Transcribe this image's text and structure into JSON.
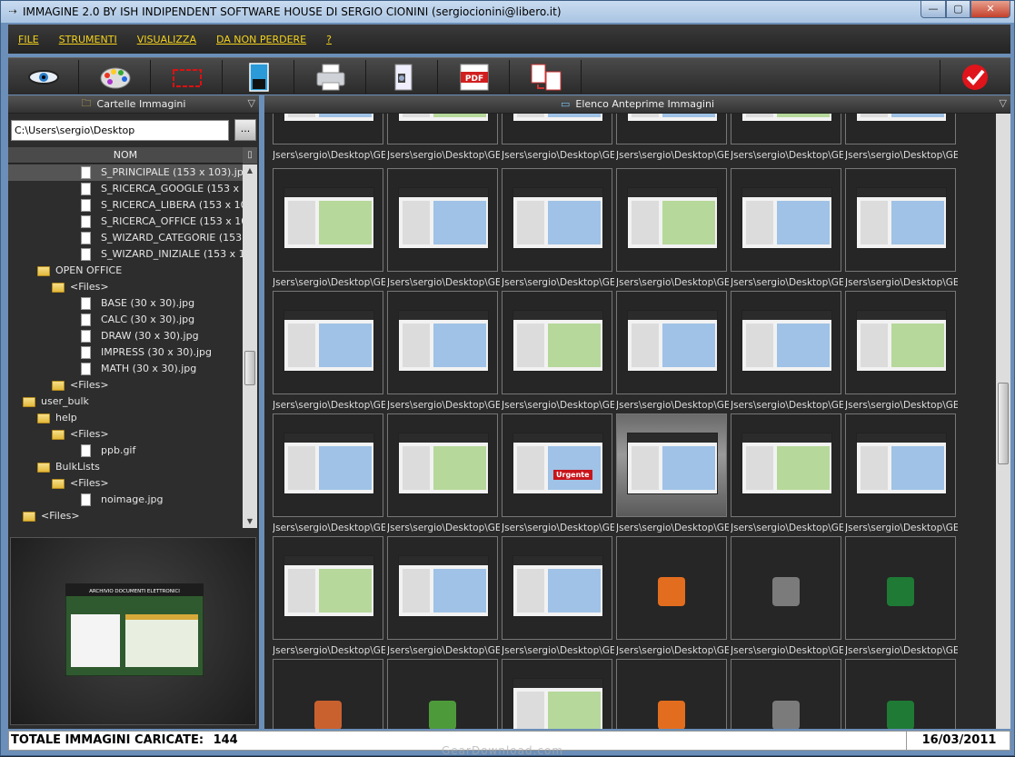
{
  "window": {
    "title": "IMMAGINE 2.0 BY ISH INDIPENDENT SOFTWARE HOUSE DI SERGIO CIONINI (sergiocionini@libero.it)",
    "controls": {
      "minimize": "—",
      "maximize": "▢",
      "close": "✕"
    }
  },
  "menu": [
    "FILE",
    "STRUMENTI",
    "VISUALIZZA",
    "DA NON PERDERE",
    "?"
  ],
  "toolbar": {
    "buttons": [
      {
        "icon": "eye-icon"
      },
      {
        "icon": "palette-icon"
      },
      {
        "icon": "crop-frame-icon"
      },
      {
        "icon": "save-disk-icon"
      },
      {
        "icon": "printer-icon"
      },
      {
        "icon": "scanner-icon"
      },
      {
        "icon": "pdf-icon"
      },
      {
        "icon": "convert-icon"
      }
    ],
    "ok_icon": "checkmark-icon",
    "colors": {
      "ok": "#e0141b",
      "pdf": "#d11f1f"
    }
  },
  "left_panel": {
    "header": "Cartelle Immagini",
    "path_value": "C:\\Users\\sergio\\Desktop",
    "browse_label": "...",
    "column_header": "NOM",
    "tree": [
      {
        "label": "S_PRINCIPALE (153 x 103).jpg",
        "kind": "file",
        "selected": true
      },
      {
        "label": "S_RICERCA_GOOGLE (153 x 103",
        "kind": "file"
      },
      {
        "label": "S_RICERCA_LIBERA (153 x 103)",
        "kind": "file"
      },
      {
        "label": "S_RICERCA_OFFICE (153 x 103",
        "kind": "file"
      },
      {
        "label": "S_WIZARD_CATEGORIE (153 x 1",
        "kind": "file"
      },
      {
        "label": "S_WIZARD_INIZIALE (153 x 103",
        "kind": "file"
      },
      {
        "label": "OPEN OFFICE",
        "kind": "folder"
      },
      {
        "label": "<Files>",
        "kind": "folder"
      },
      {
        "label": "BASE (30 x 30).jpg",
        "kind": "file"
      },
      {
        "label": "CALC (30 x 30).jpg",
        "kind": "file"
      },
      {
        "label": "DRAW (30 x 30).jpg",
        "kind": "file"
      },
      {
        "label": "IMPRESS (30 x 30).jpg",
        "kind": "file"
      },
      {
        "label": "MATH (30 x 30).jpg",
        "kind": "file"
      },
      {
        "label": "<Files>",
        "kind": "folder"
      },
      {
        "label": "user_bulk",
        "kind": "folder"
      },
      {
        "label": "help",
        "kind": "folder"
      },
      {
        "label": "<Files>",
        "kind": "folder"
      },
      {
        "label": "ppb.gif",
        "kind": "file"
      },
      {
        "label": "BulkLists",
        "kind": "folder"
      },
      {
        "label": "<Files>",
        "kind": "folder"
      },
      {
        "label": "noimage.jpg",
        "kind": "file"
      },
      {
        "label": "<Files>",
        "kind": "folder"
      }
    ],
    "preview_caption": "ARCHIVIO DOCUMENTI ELETTRONICI"
  },
  "right_panel": {
    "header": "Elenco Anteprime Immagini",
    "cell_label": "Jsers\\sergio\\Desktop\\GE",
    "rows": [
      {
        "kind": "screen"
      },
      {
        "kind": "screen"
      },
      {
        "kind": "screen"
      },
      {
        "kind": "screen"
      },
      {
        "kind": "mixed"
      },
      {
        "kind": "icons"
      }
    ],
    "urgent_label": "Urgente"
  },
  "status": {
    "total_label": "TOTALE IMMAGINI CARICATE:",
    "total_value": "144",
    "date": "16/03/2011"
  },
  "watermark": "GearDownload.com"
}
